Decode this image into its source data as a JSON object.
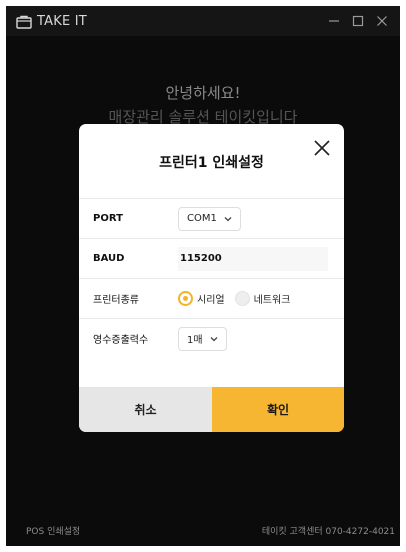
{
  "window": {
    "title": "TAKE IT",
    "logo_icon": "store-bag-icon",
    "controls": [
      "minimize-icon",
      "maximize-icon",
      "close-icon"
    ]
  },
  "background": {
    "welcome": "안녕하세요!",
    "subtitle": "매장관리 솔루션 테이킷입니다"
  },
  "dialog": {
    "title": "프린터1 인쇄설정",
    "close_icon": "close-icon",
    "port": {
      "label": "PORT",
      "value": "COM1"
    },
    "baud": {
      "label": "BAUD",
      "value": "115200"
    },
    "printer_type": {
      "label": "프린터종류",
      "options": [
        {
          "label": "시리얼",
          "selected": true
        },
        {
          "label": "네트워크",
          "selected": false
        }
      ]
    },
    "receipt_count": {
      "label": "영수증출력수",
      "value": "1매"
    },
    "cancel_label": "취소",
    "confirm_label": "확인"
  },
  "footer": {
    "left": "POS 인쇄설정",
    "right": "테이킷 고객센터 070-4272-4021"
  },
  "colors": {
    "accent": "#f7b632",
    "window_bg": "#0b0b0b",
    "titlebar_bg": "#151515",
    "cancel_bg": "#e6e6e6"
  }
}
